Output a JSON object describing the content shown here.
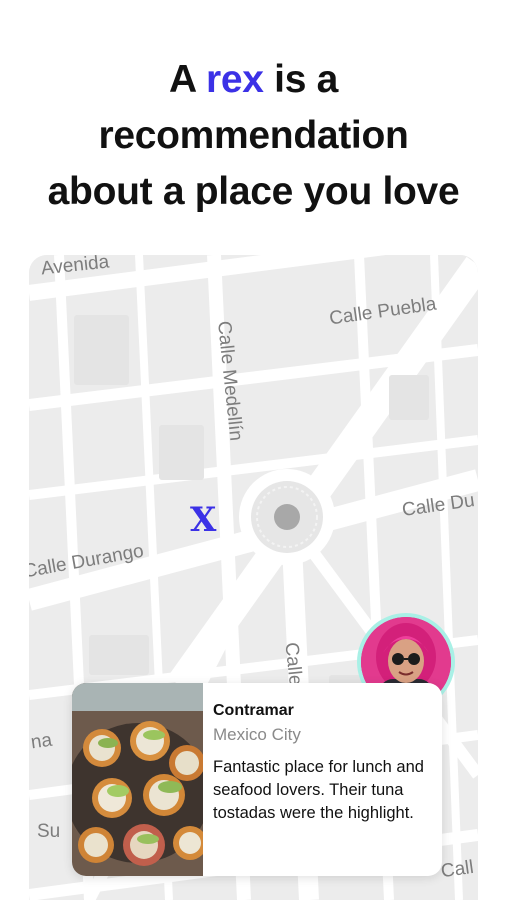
{
  "headline": {
    "prefix": "A",
    "highlight": "rex",
    "suffix": "is a",
    "line2": "recommendation",
    "line3": "about a place you love"
  },
  "colors": {
    "accent": "#3b31e6",
    "map_background": "#ececec",
    "road": "#ffffff",
    "avatar_ring": "#a9f0e6"
  },
  "map": {
    "streets": {
      "avenida": "Avenida",
      "calle_puebla": "Calle Puebla",
      "calle_medellin": "Calle Medellín",
      "calle_du": "Calle Du",
      "calle_durango": "Calle Durango",
      "calle_bottom": "Calle",
      "na": "na",
      "su": "Su",
      "call": "Call"
    },
    "marker_icon": "rex-x-marker-icon",
    "roundabout_icon": "roundabout-icon"
  },
  "recommendation": {
    "place": "Contramar",
    "city": "Mexico City",
    "description": "Fantastic place for lunch and seafood lovers. Their tuna tostadas were the highlight.",
    "photo_icon": "tostadas-photo",
    "avatar_icon": "user-avatar"
  }
}
